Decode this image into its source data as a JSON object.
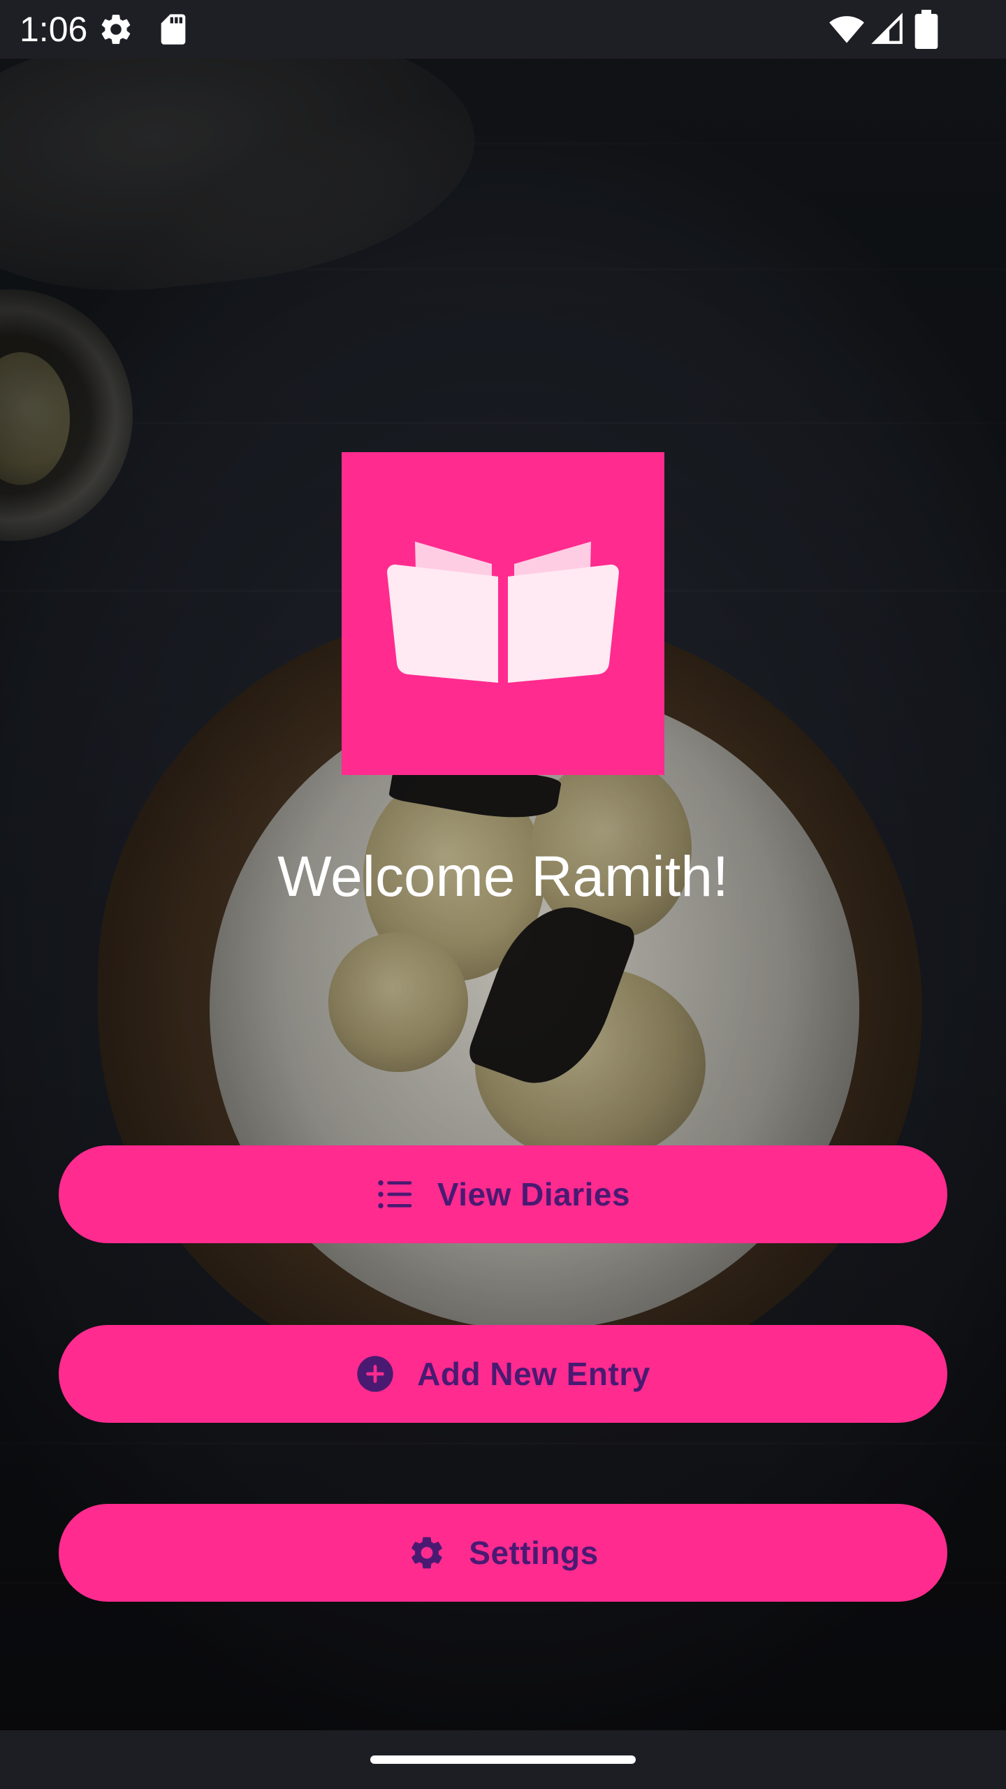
{
  "status_bar": {
    "time": "1:06",
    "icons": [
      "settings-gear-icon",
      "sd-card-icon",
      "wifi-icon",
      "signal-icon",
      "battery-icon"
    ]
  },
  "logo": {
    "icon": "open-book-icon",
    "background_color": "#ff2b8f"
  },
  "welcome": {
    "text": "Welcome Ramith!"
  },
  "buttons": {
    "view_diaries": {
      "label": "View Diaries",
      "icon": "list-icon"
    },
    "add_new_entry": {
      "label": "Add New Entry",
      "icon": "add-circle-icon"
    },
    "settings": {
      "label": "Settings",
      "icon": "gear-icon"
    }
  },
  "colors": {
    "accent": "#ff2b8f",
    "button_text": "#4a1a72"
  }
}
